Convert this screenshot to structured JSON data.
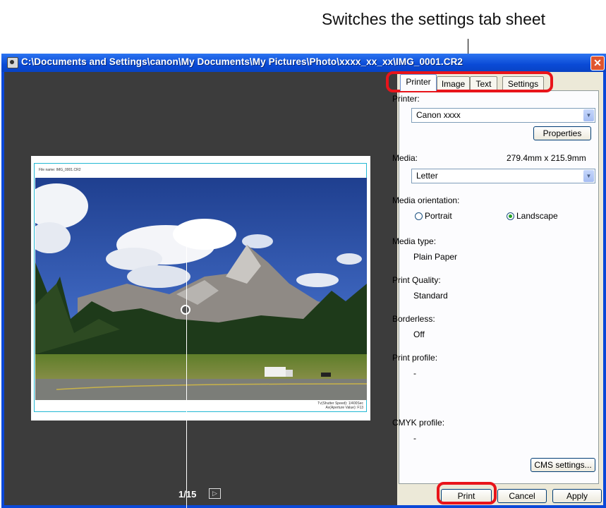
{
  "callout": {
    "text": "Switches the settings tab sheet"
  },
  "window": {
    "title": "C:\\Documents and Settings\\canon\\My Documents\\My Pictures\\Photo\\xxxx_xx_xx\\IMG_0001.CR2",
    "close_label": "✕"
  },
  "preview": {
    "file_name": "File name: IMG_0001.CR2",
    "shot_info_line1": "Tv(Shutter Speed): 1/400Sec",
    "shot_info_line2": "Av(Aperture Value): F13",
    "page_counter": "1/15",
    "next_icon": "▷"
  },
  "tabs": [
    {
      "label": "Printer",
      "active": true
    },
    {
      "label": "Image",
      "active": false
    },
    {
      "label": "Text",
      "active": false
    },
    {
      "label": "Settings",
      "active": false
    }
  ],
  "printer_tab": {
    "printer_label": "Printer:",
    "printer_value": "Canon xxxx",
    "properties_label": "Properties",
    "media_label": "Media:",
    "media_size": "279.4mm x 215.9mm",
    "media_value": "Letter",
    "orientation_label": "Media orientation:",
    "portrait_label": "Portrait",
    "landscape_label": "Landscape",
    "orientation_selected": "Landscape",
    "media_type_label": "Media type:",
    "media_type_value": "Plain Paper",
    "quality_label": "Print Quality:",
    "quality_value": "Standard",
    "borderless_label": "Borderless:",
    "borderless_value": "Off",
    "print_profile_label": "Print profile:",
    "print_profile_value": "-",
    "cmyk_profile_label": "CMYK profile:",
    "cmyk_profile_value": "-",
    "cms_settings_label": "CMS settings..."
  },
  "buttons": {
    "print": "Print",
    "cancel": "Cancel",
    "apply": "Apply"
  },
  "colors": {
    "highlight": "#e8141a",
    "titlebar": "#0a4ad6",
    "preview_bg": "#3c3c3c"
  }
}
